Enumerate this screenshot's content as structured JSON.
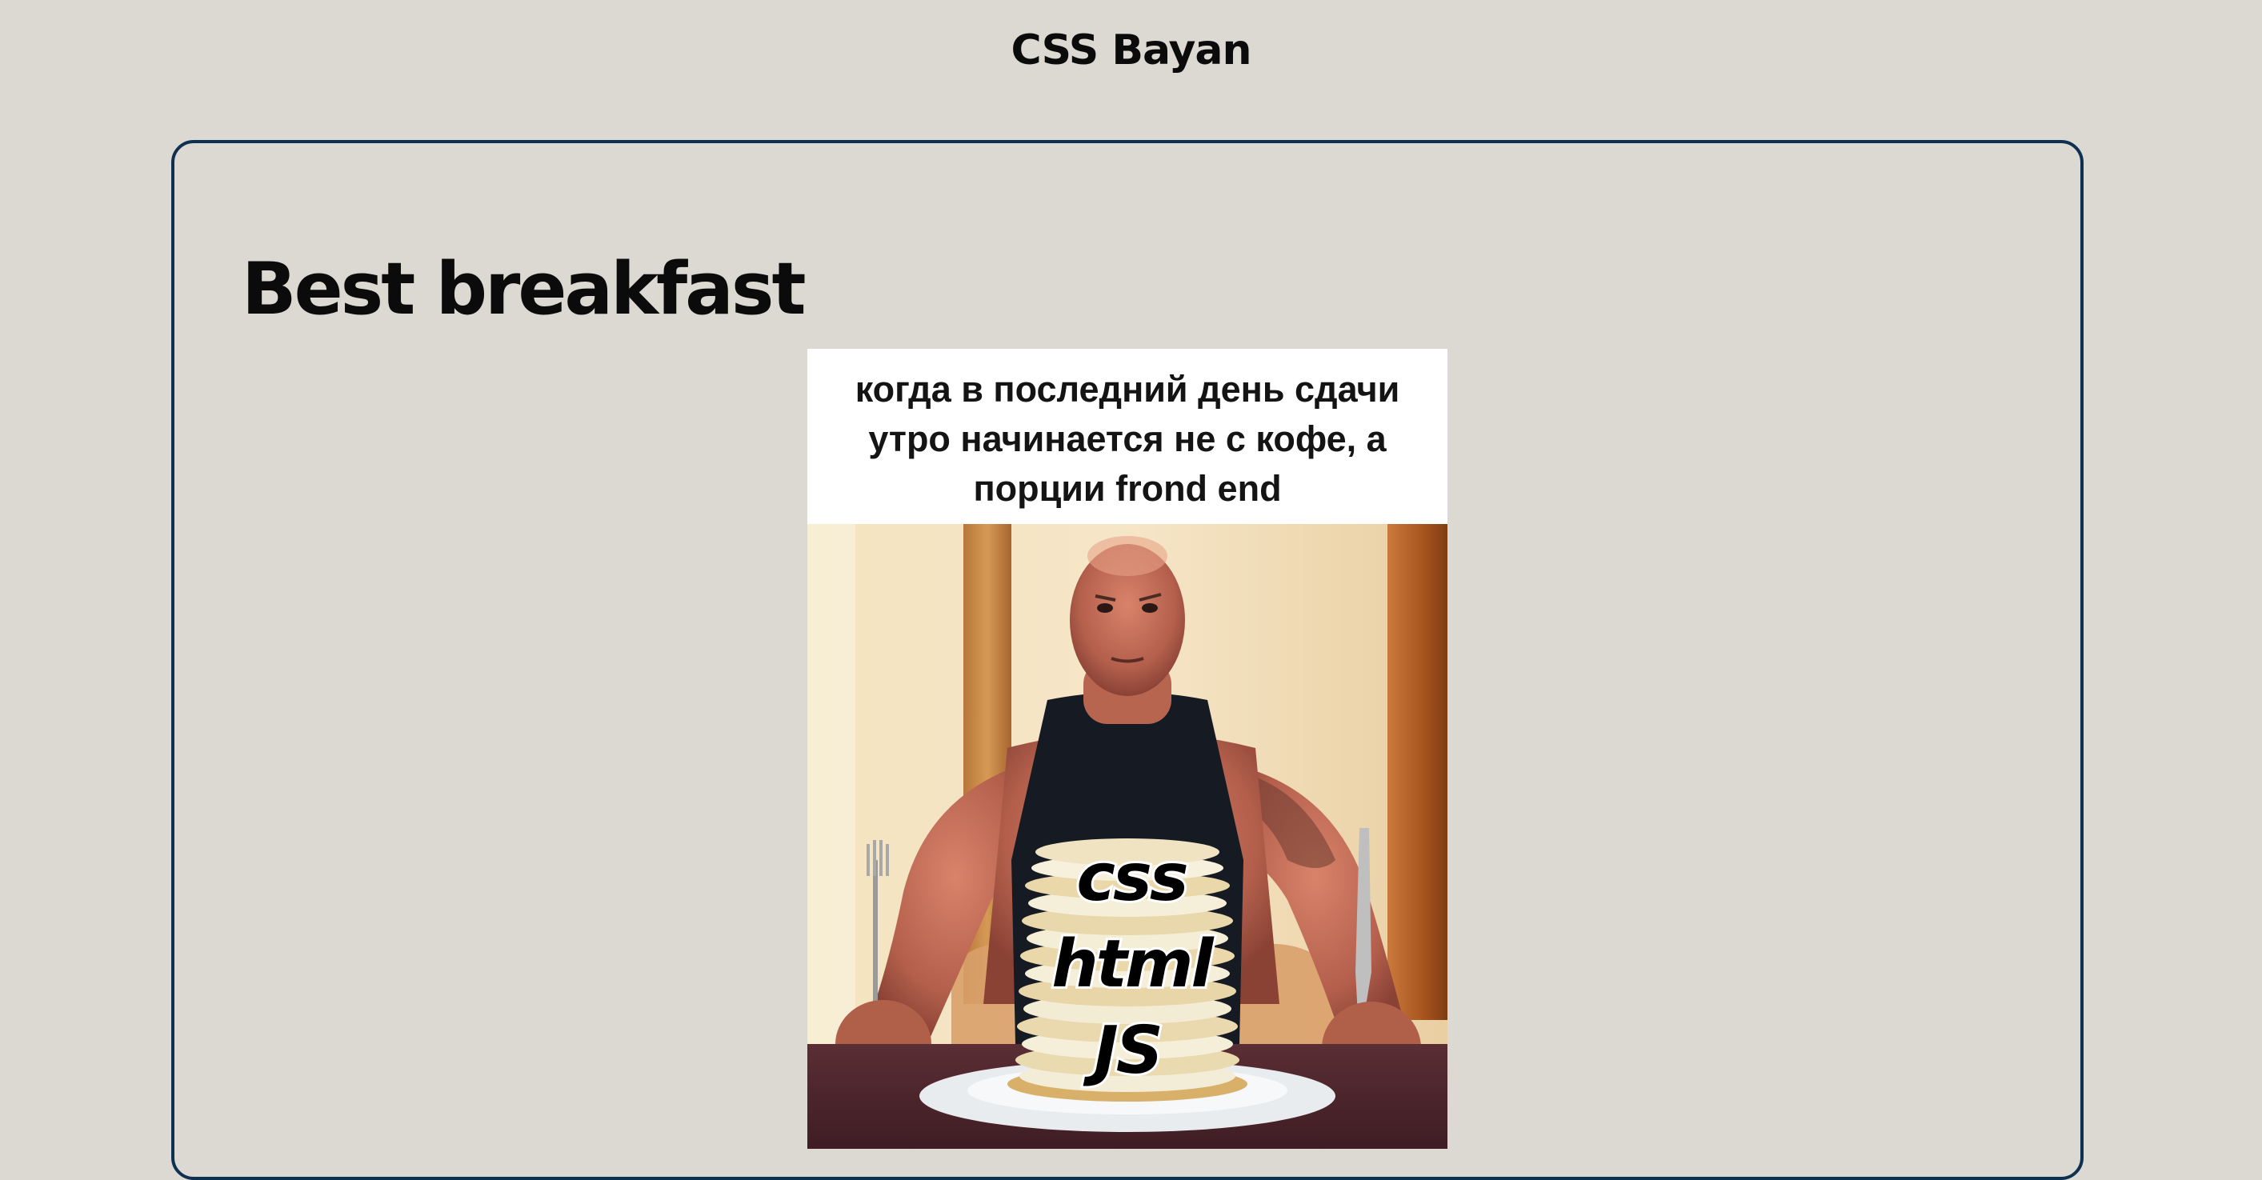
{
  "header": {
    "site_title": "CSS Bayan"
  },
  "post": {
    "title": "Best breakfast",
    "meme": {
      "caption_lines": [
        "когда в последний день сдачи",
        "утро начинается не с кофе, а",
        "порции frond end"
      ],
      "stack_words": [
        "css",
        "html",
        "JS"
      ]
    }
  },
  "colors": {
    "background": "#dcd9d2",
    "card_border": "#0e3152",
    "text": "#0b0b0b"
  }
}
